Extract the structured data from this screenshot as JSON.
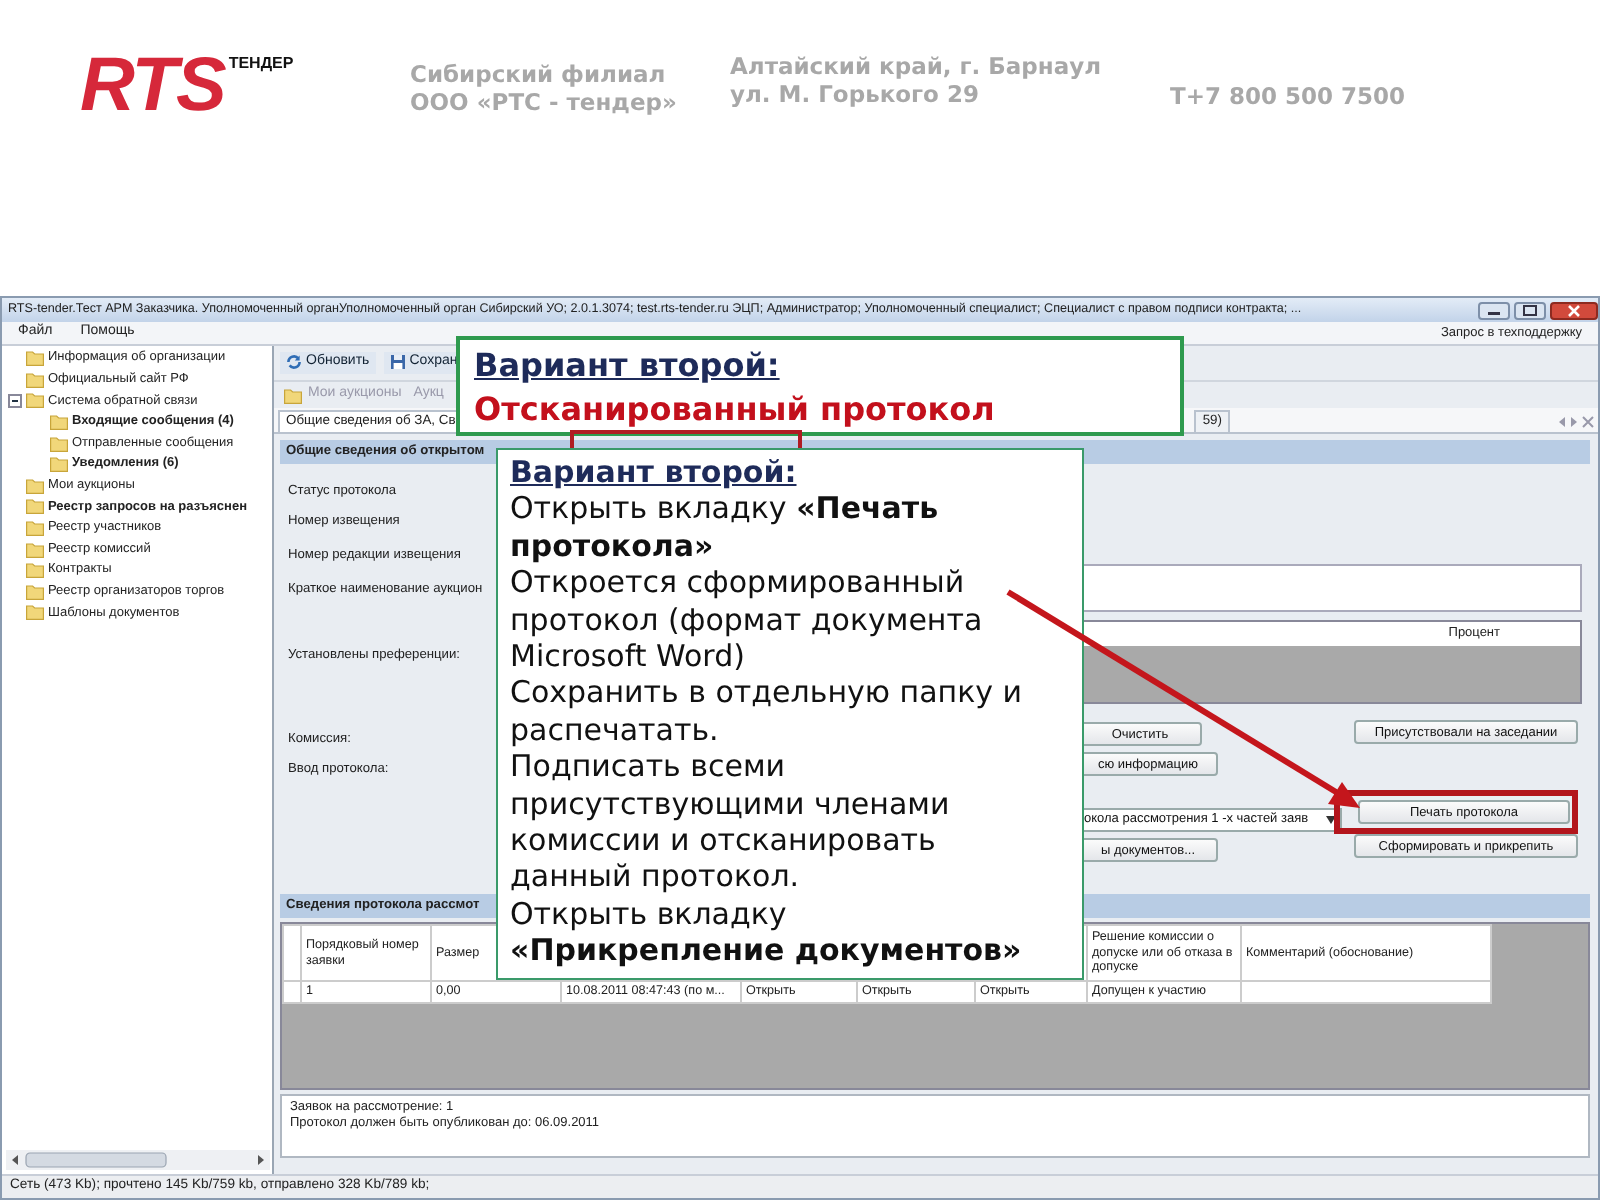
{
  "header": {
    "logo": "RTS",
    "logo_tag": "ТЕНДЕР",
    "branch": [
      "Сибирский филиал",
      "ООО «РТС - тендер»"
    ],
    "address": [
      "Алтайский край, г. Барнаул",
      "ул. М. Горького 29"
    ],
    "phone": "Т+7 800 500 7500"
  },
  "app": {
    "window_title": "RTS-tender.Тест АРМ Заказчика. Уполномоченный органУполномоченный орган Сибирский УО; 2.0.1.3074; test.rts-tender.ru  ЭЦП; Администратор; Уполномоченный специалист; Специалист с правом подписи контракта; ...",
    "menu": [
      "Файл",
      "Помощь"
    ],
    "support_link": "Запрос в техподдержку",
    "sidebar": {
      "items": [
        {
          "label": "Информация об организации",
          "unread": false
        },
        {
          "label": "Официальный сайт РФ",
          "unread": false
        },
        {
          "label": "Система обратной связи",
          "unread": false,
          "expanded": true,
          "children": [
            {
              "label": "Входящие сообщения (4)",
              "unread": true
            },
            {
              "label": "Отправленные сообщения",
              "unread": false
            },
            {
              "label": "Уведомления (6)",
              "unread": true
            }
          ]
        },
        {
          "label": "Мои аукционы",
          "unread": false
        },
        {
          "label": "Реестр запросов на разъяснен",
          "unread": true
        },
        {
          "label": "Реестр участников",
          "unread": false
        },
        {
          "label": "Реестр комиссий",
          "unread": false
        },
        {
          "label": "Контракты",
          "unread": false
        },
        {
          "label": "Реестр организаторов торгов",
          "unread": false
        },
        {
          "label": "Шаблоны документов",
          "unread": false
        }
      ]
    },
    "toolbar": [
      {
        "kind": "refresh",
        "label": "Обновить"
      },
      {
        "kind": "save",
        "label": "Сохран"
      }
    ],
    "subtoolbar": [
      "Мои аукционы",
      "Аукц"
    ],
    "tabs": [
      {
        "label": "Общие сведения об ЗА, Св",
        "selected": true
      },
      {
        "label": "59)",
        "selected": false
      }
    ],
    "form": {
      "title": "Общие сведения об открытом",
      "labels": [
        "Статус протокола",
        "Номер извещения",
        "Номер редакции извещения",
        "Краткое наименование аукцион",
        "Установлены преференции:",
        "Комиссия:",
        "Ввод протокола:"
      ],
      "percent_header": "Процент",
      "controls_left": [
        {
          "kind": "button",
          "label": "Очистить"
        },
        {
          "kind": "button",
          "label": "сю информацию"
        },
        {
          "kind": "select",
          "label": "окола рассмотрения 1 -х частей заяв"
        },
        {
          "kind": "button",
          "label": "ы документов..."
        }
      ],
      "controls_right": [
        {
          "label": "Присутствовали на заседании",
          "highlighted": false
        },
        {
          "label": "Печать протокола",
          "highlighted": true
        },
        {
          "label": "Сформировать и прикрепить",
          "highlighted": false
        }
      ]
    },
    "protocol_table": {
      "title": "Сведения протокола рассмот",
      "columns": [
        {
          "label": "Порядковый номер заявки"
        },
        {
          "label": "Размер"
        },
        {},
        {},
        {},
        {},
        {
          "label": "Решение комиссии о допуске или об отказа в допуске"
        },
        {
          "label": "Комментарий (обоснование)"
        }
      ],
      "rows": [
        [
          "1",
          "0,00",
          "10.08.2011 08:47:43 (по м...",
          "Открыть",
          "Открыть",
          "Открыть",
          "Допущен к участию"
        ]
      ]
    },
    "info_lines": [
      "Заявок на рассмотрение: 1",
      "Протокол должен быть опубликован до: 06.09.2011"
    ],
    "status_bar": "Сеть (473 Kb); прочтено 145 Kb/759 kb, отправлено 328 Kb/789 kb;"
  },
  "callouts": {
    "title": {
      "heading": "Вариант второй:",
      "subheading": "Отсканированный протокол"
    },
    "steps": {
      "heading": "Вариант второй:",
      "paragraphs": [
        "Открыть вкладку **«Печать протокола»**",
        "Откроется сформированный протокол (формат документа Microsoft Word)",
        "Сохранить в отдельную папку и распечатать.",
        "Подписать всеми присутствующими членами комиссии и отсканировать данный протокол.",
        "Открыть вкладку **«Прикрепление документов»**"
      ]
    }
  }
}
